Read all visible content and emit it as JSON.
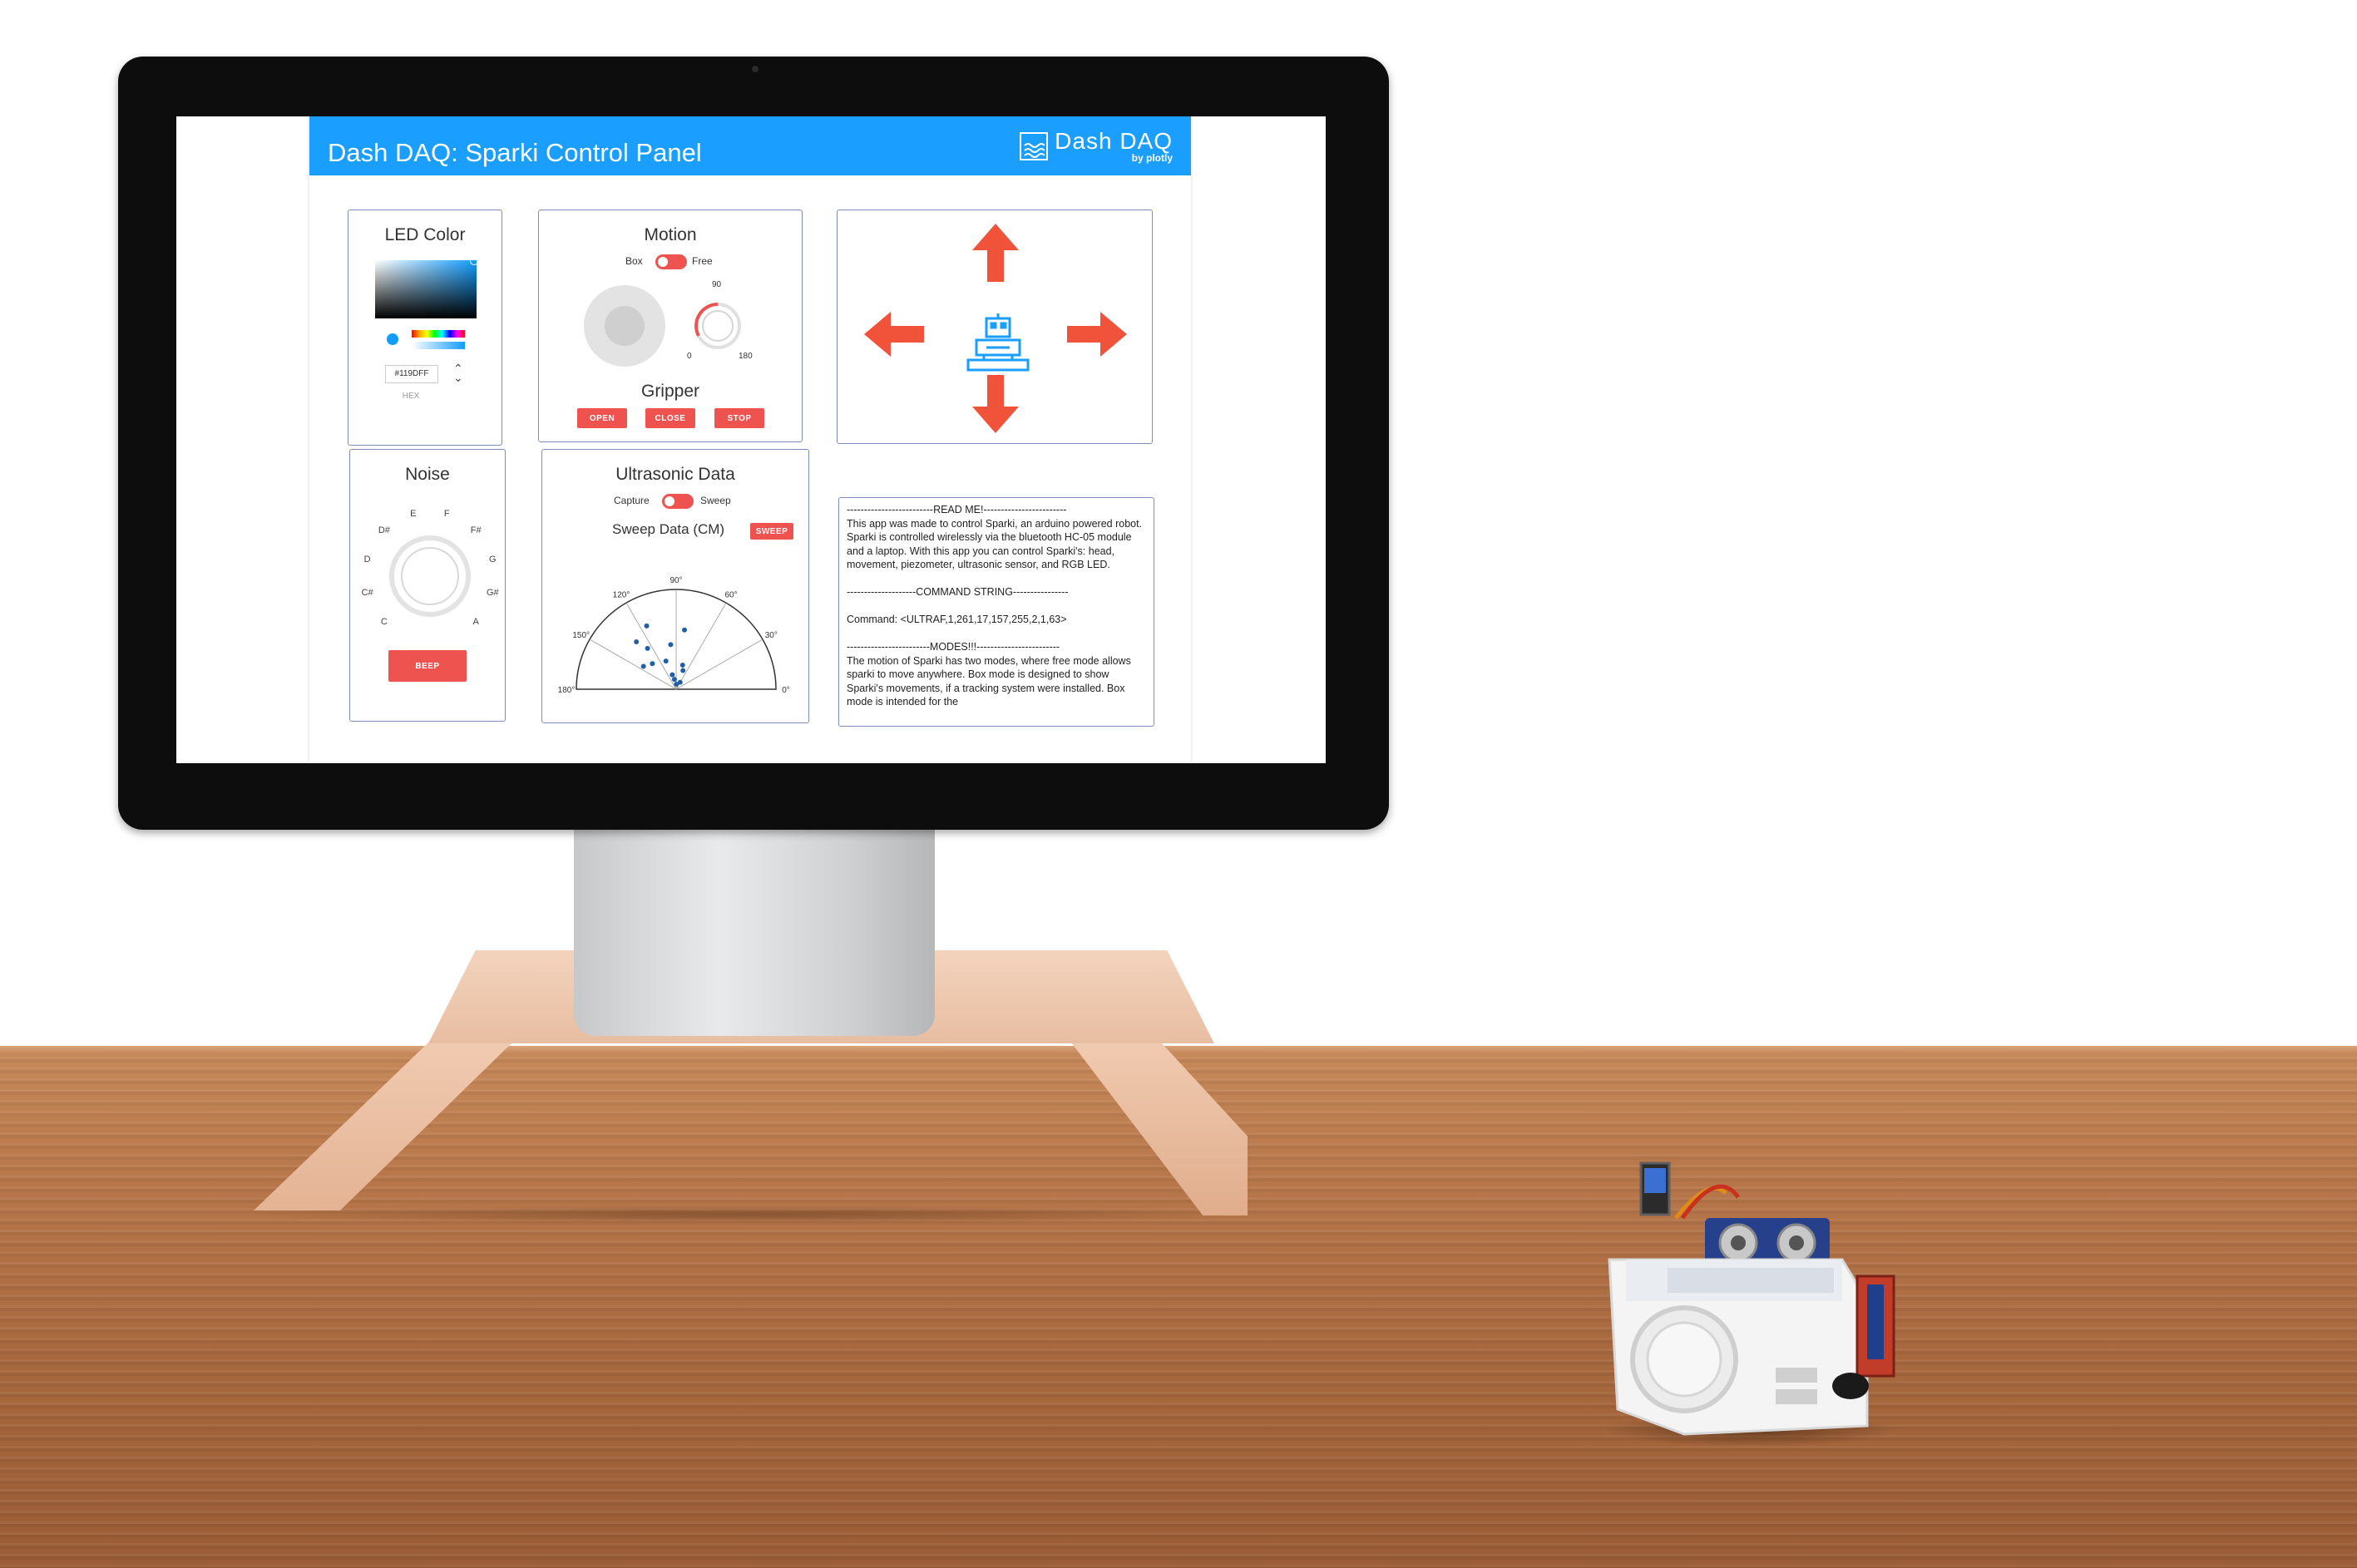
{
  "app": {
    "title": "Dash DAQ: Sparki Control Panel",
    "logo": {
      "main": "Dash DAQ",
      "sub": "by plotly"
    },
    "accent_color": "#1a9eff",
    "button_color": "#ef5350",
    "arrow_color": "#f0533a"
  },
  "led": {
    "title": "LED Color",
    "hex_value": "#119DFF",
    "hex_label": "HEX"
  },
  "motion": {
    "title": "Motion",
    "toggle_left": "Box",
    "toggle_right": "Free",
    "knob_top": "90",
    "knob_min": "0",
    "knob_max": "180"
  },
  "gripper": {
    "title": "Gripper",
    "open_label": "OPEN",
    "close_label": "CLOSE",
    "stop_label": "STOP"
  },
  "noise": {
    "title": "Noise",
    "notes": [
      "C",
      "C#",
      "D",
      "D#",
      "E",
      "F",
      "F#",
      "G",
      "G#",
      "A"
    ],
    "beep_label": "BEEP"
  },
  "ultrasonic": {
    "title": "Ultrasonic Data",
    "toggle_left": "Capture",
    "toggle_right": "Sweep",
    "sweep_title": "Sweep Data (CM)",
    "sweep_label": "SWEEP"
  },
  "chart_data": {
    "type": "scatter",
    "title": "",
    "angular_ticks": [
      "0°",
      "30°",
      "60°",
      "90°",
      "120°",
      "150°",
      "180°"
    ],
    "points": [
      {
        "theta": 82,
        "r": 0.6
      },
      {
        "theta": 97,
        "r": 0.45
      },
      {
        "theta": 110,
        "r": 0.3
      },
      {
        "theta": 75,
        "r": 0.25
      },
      {
        "theta": 70,
        "r": 0.2
      },
      {
        "theta": 125,
        "r": 0.5
      },
      {
        "theta": 133,
        "r": 0.35
      },
      {
        "theta": 130,
        "r": 0.62
      },
      {
        "theta": 145,
        "r": 0.4
      },
      {
        "theta": 105,
        "r": 0.15
      },
      {
        "theta": 100,
        "r": 0.1
      },
      {
        "theta": 88,
        "r": 0.05
      },
      {
        "theta": 60,
        "r": 0.08
      },
      {
        "theta": 115,
        "r": 0.7
      }
    ],
    "point_color": "#1f5fa8"
  },
  "readme": {
    "header": "-------------------------READ ME!------------------------",
    "body": "This app was made to control Sparki, an arduino powered robot. Sparki is controlled wirelessly via the bluetooth HC-05 module and a laptop. With this app you can control Sparki's: head, movement, piezometer, ultrasonic sensor, and RGB LED.",
    "command_header": "--------------------COMMAND STRING----------------",
    "command": "Command: <ULTRAF,1,261,17,157,255,2,1,63>",
    "modes_header": "------------------------MODES!!!------------------------",
    "modes_body": "The motion of Sparki has two modes, where free mode allows sparki to move anywhere. Box mode is designed to show Sparki's movements, if a tracking system were installed. Box mode is intended for the"
  }
}
